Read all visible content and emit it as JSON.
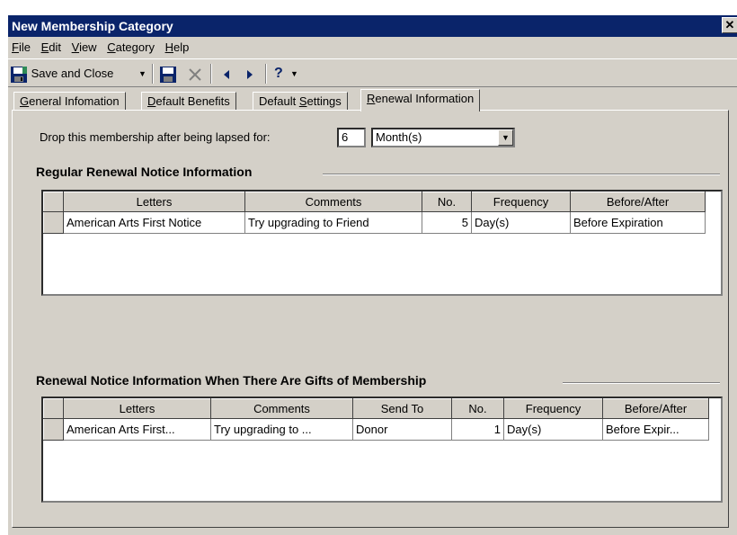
{
  "window": {
    "title": "New Membership Category"
  },
  "menu": [
    {
      "mnemonic": "F",
      "rest": "ile"
    },
    {
      "mnemonic": "E",
      "rest": "dit"
    },
    {
      "mnemonic": "V",
      "rest": "iew"
    },
    {
      "mnemonic": "C",
      "rest": "ategory"
    },
    {
      "mnemonic": "H",
      "rest": "elp"
    }
  ],
  "toolbar": {
    "save_close_label": "Save and Close",
    "help_label": "?"
  },
  "tabs": [
    {
      "mnemonic": "G",
      "rest": "eneral Infomation",
      "active": false
    },
    {
      "mnemonic": "D",
      "rest": "efault Benefits",
      "active": false
    },
    {
      "pre": "Default ",
      "mnemonic": "S",
      "rest": "ettings",
      "active": false
    },
    {
      "mnemonic": "R",
      "rest": "enewal Information",
      "active": true
    }
  ],
  "drop": {
    "label": "Drop this membership after being lapsed for:",
    "value": "6",
    "unit": "Month(s)"
  },
  "regular": {
    "title": "Regular Renewal Notice Information",
    "columns": [
      "Letters",
      "Comments",
      "No.",
      "Frequency",
      "Before/After"
    ],
    "rows": [
      {
        "letters": "American Arts First Notice",
        "comments": "Try upgrading to Friend",
        "no": "5",
        "frequency": "Day(s)",
        "before_after": "Before Expiration"
      }
    ]
  },
  "gifts": {
    "title": "Renewal Notice Information When There Are Gifts of Membership",
    "columns": [
      "Letters",
      "Comments",
      "Send To",
      "No.",
      "Frequency",
      "Before/After"
    ],
    "rows": [
      {
        "letters": "American Arts First...",
        "comments": "Try upgrading to ...",
        "send_to": "Donor",
        "no": "1",
        "frequency": "Day(s)",
        "before_after": "Before Expir..."
      }
    ]
  }
}
